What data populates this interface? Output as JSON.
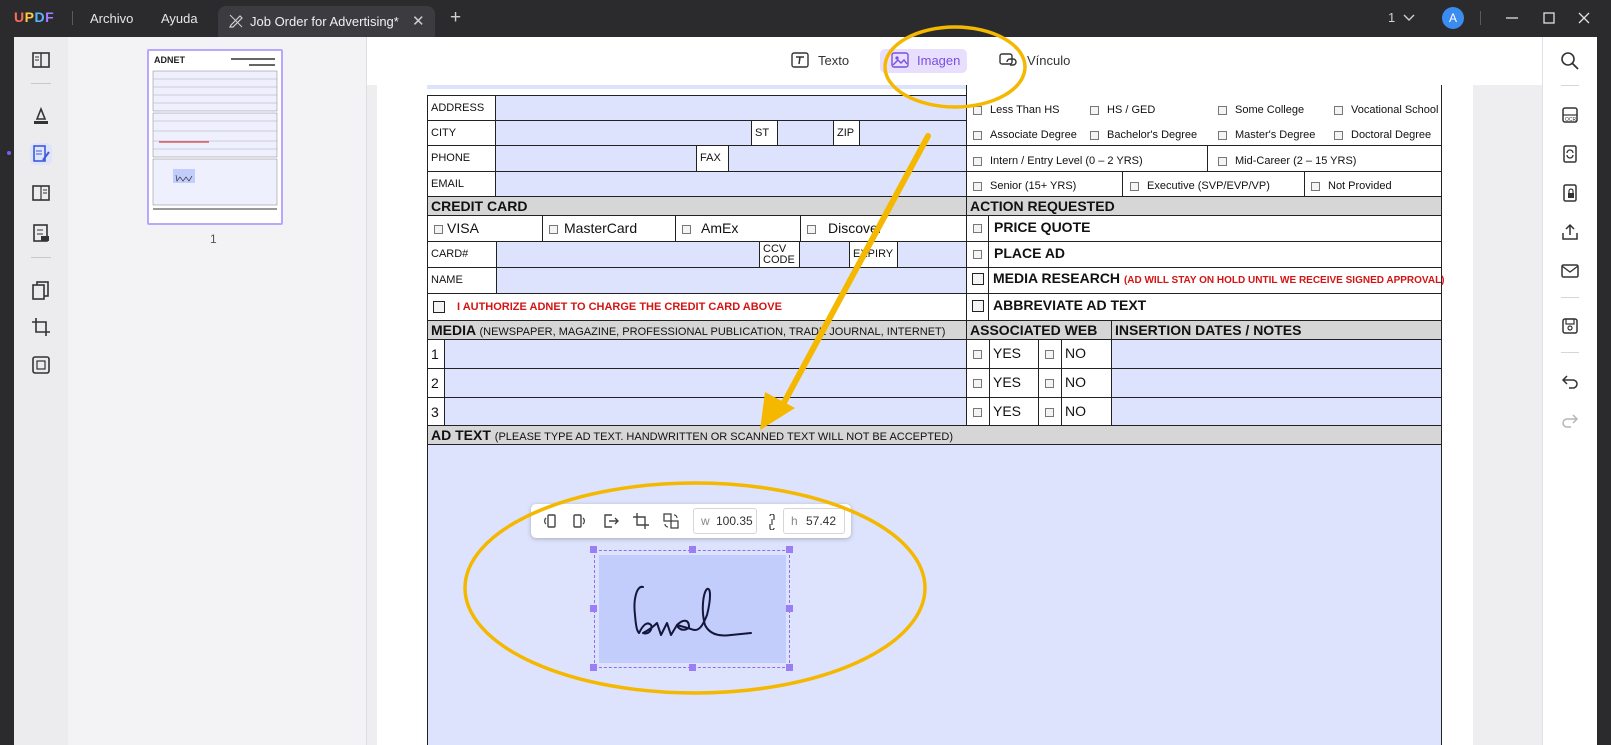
{
  "app": {
    "logo_parts": [
      "U",
      "P",
      "D",
      "F"
    ],
    "menu": {
      "file": "Archivo",
      "help": "Ayuda"
    },
    "tab_title": "Job Order for Advertising*",
    "page_count": "1",
    "avatar_letter": "A"
  },
  "thumbnails": {
    "page_number": "1"
  },
  "edit_toolbar": {
    "text_label": "Texto",
    "image_label": "Imagen",
    "link_label": "Vínculo"
  },
  "image_toolbar": {
    "w_key": "w",
    "w_value": "100.35",
    "h_key": "h",
    "h_value": "57.42"
  },
  "form": {
    "labels": {
      "address": "ADDRESS",
      "city": "CITY",
      "st": "ST",
      "zip": "ZIP",
      "phone": "PHONE",
      "fax": "FAX",
      "email": "EMAIL"
    },
    "education": [
      "Less Than HS",
      "HS / GED",
      "Some College",
      "Vocational School",
      "Associate Degree",
      "Bachelor's Degree",
      "Master's Degree",
      "Doctoral Degree"
    ],
    "experience": [
      "Intern / Entry Level (0 – 2 YRS)",
      "Mid-Career (2 – 15 YRS)",
      "Senior (15+ YRS)",
      "Executive (SVP/EVP/VP)",
      "Not Provided"
    ],
    "credit_card": {
      "header": "CREDIT CARD",
      "cards": [
        "VISA",
        "MasterCard",
        "AmEx",
        "Discover"
      ],
      "card_label": "CARD#",
      "ccv_label_1": "CCV",
      "ccv_label_2": "CODE",
      "expiry_label": "EXPIRY",
      "name_label": "NAME",
      "authorize": "I AUTHORIZE ADNET TO CHARGE THE CREDIT CARD ABOVE"
    },
    "action": {
      "header": "ACTION REQUESTED",
      "price_quote": "PRICE QUOTE",
      "place_ad": "PLACE AD",
      "media_research": "MEDIA RESEARCH",
      "media_research_note": "(AD WILL STAY ON HOLD UNTIL WE RECEIVE SIGNED APPROVAL)",
      "abbreviate": "ABBREVIATE AD TEXT"
    },
    "media": {
      "header": "MEDIA",
      "header_sub": "(NEWSPAPER, MAGAZINE, PROFESSIONAL PUBLICATION, TRADE JOURNAL, INTERNET)",
      "assoc_web": "ASSOCIATED WEB",
      "insertion": "INSERTION DATES / NOTES",
      "rows": [
        "1",
        "2",
        "3"
      ],
      "yes": "YES",
      "no": "NO"
    },
    "ad_text": {
      "header": "AD TEXT",
      "header_sub": "(PLEASE TYPE AD TEXT. HANDWRITTEN OR SCANNED TEXT WILL NOT BE ACCEPTED)"
    }
  },
  "colors": {
    "accent": "#7a4fe0",
    "annotation": "#f5b800",
    "field_fill": "#dde3fc",
    "titlebar": "#2b2b2e"
  }
}
